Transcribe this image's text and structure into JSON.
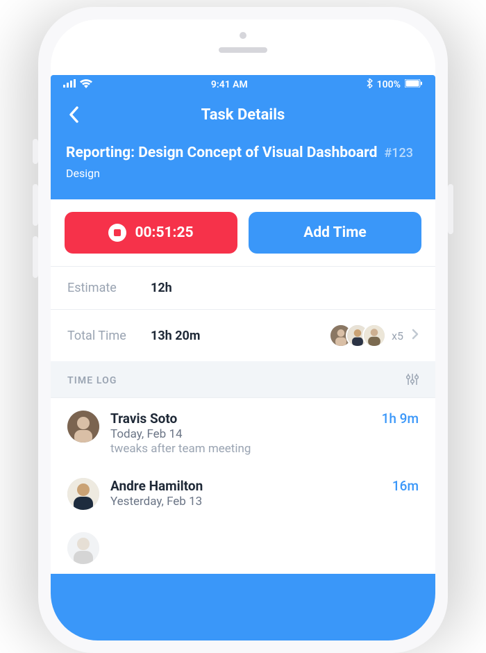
{
  "status": {
    "time": "9:41 AM",
    "battery": "100%"
  },
  "nav": {
    "title": "Task Details"
  },
  "task": {
    "title": "Reporting: Design Concept of Visual Dashboard",
    "ref": "#123",
    "category": "Design"
  },
  "actions": {
    "timer_value": "00:51:25",
    "add_time_label": "Add Time"
  },
  "estimate": {
    "label": "Estimate",
    "value": "12h"
  },
  "total_time": {
    "label": "Total Time",
    "value": "13h 20m",
    "extra_count": "x5"
  },
  "time_log": {
    "section_label": "TIME LOG",
    "entries": [
      {
        "name": "Travis Soto",
        "date": "Today, Feb 14",
        "note": "tweaks after team meeting",
        "duration": "1h 9m"
      },
      {
        "name": "Andre Hamilton",
        "date": "Yesterday, Feb 13",
        "note": "",
        "duration": "16m"
      }
    ]
  },
  "colors": {
    "primary": "#3A97F9",
    "danger": "#F6324A",
    "text": "#1F2937",
    "muted": "#9AA4B2"
  }
}
